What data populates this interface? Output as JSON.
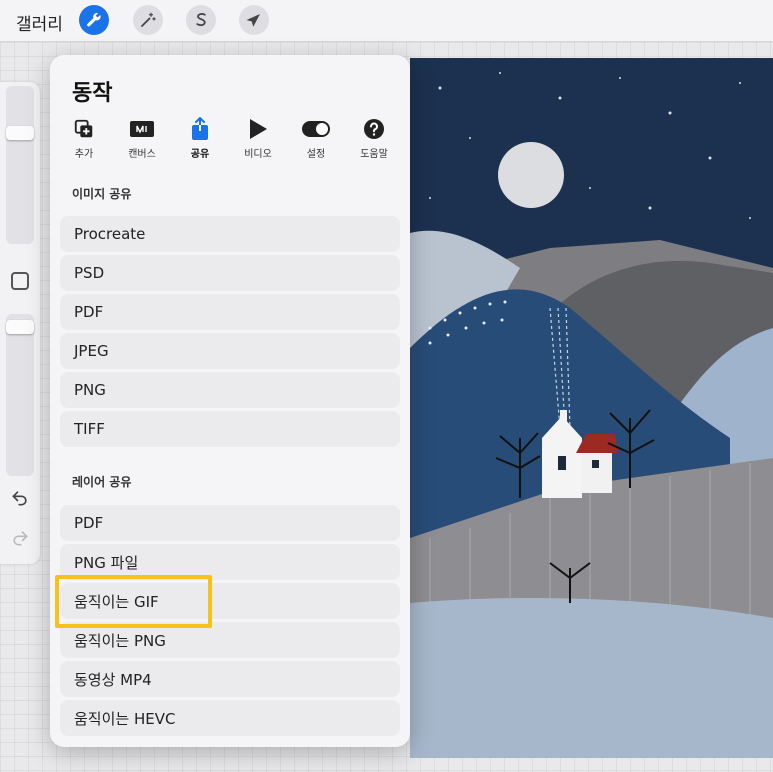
{
  "topbar": {
    "gallery_label": "갤러리"
  },
  "panel": {
    "title": "동작",
    "tabs": [
      {
        "label": "추가",
        "icon": "add-icon"
      },
      {
        "label": "캔버스",
        "icon": "canvas-icon"
      },
      {
        "label": "공유",
        "icon": "share-icon"
      },
      {
        "label": "비디오",
        "icon": "play-icon"
      },
      {
        "label": "설정",
        "icon": "toggle-icon"
      },
      {
        "label": "도움말",
        "icon": "help-icon"
      }
    ],
    "image_share_label": "이미지 공유",
    "image_share": [
      "Procreate",
      "PSD",
      "PDF",
      "JPEG",
      "PNG",
      "TIFF"
    ],
    "layer_share_label": "레이어 공유",
    "layer_share": [
      "PDF",
      "PNG 파일",
      "움직이는 GIF",
      "움직이는 PNG",
      "동영상 MP4",
      "움직이는 HEVC"
    ]
  },
  "colors": {
    "accent": "#1a73e8",
    "highlight": "#f7c21b"
  }
}
